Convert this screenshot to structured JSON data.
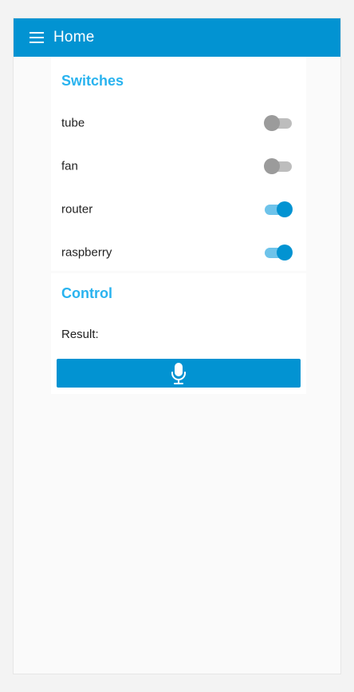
{
  "header": {
    "menu_icon": "hamburger-menu-icon",
    "title": "Home"
  },
  "switches": {
    "title": "Switches",
    "items": [
      {
        "label": "tube",
        "on": false
      },
      {
        "label": "fan",
        "on": false
      },
      {
        "label": "router",
        "on": true
      },
      {
        "label": "raspberry",
        "on": true
      }
    ]
  },
  "control": {
    "title": "Control",
    "result_label": "Result:",
    "mic_icon": "microphone-icon"
  },
  "colors": {
    "accent": "#0293d2",
    "title_blue": "#29b3ef",
    "switch_off": "#9b9b9b"
  }
}
